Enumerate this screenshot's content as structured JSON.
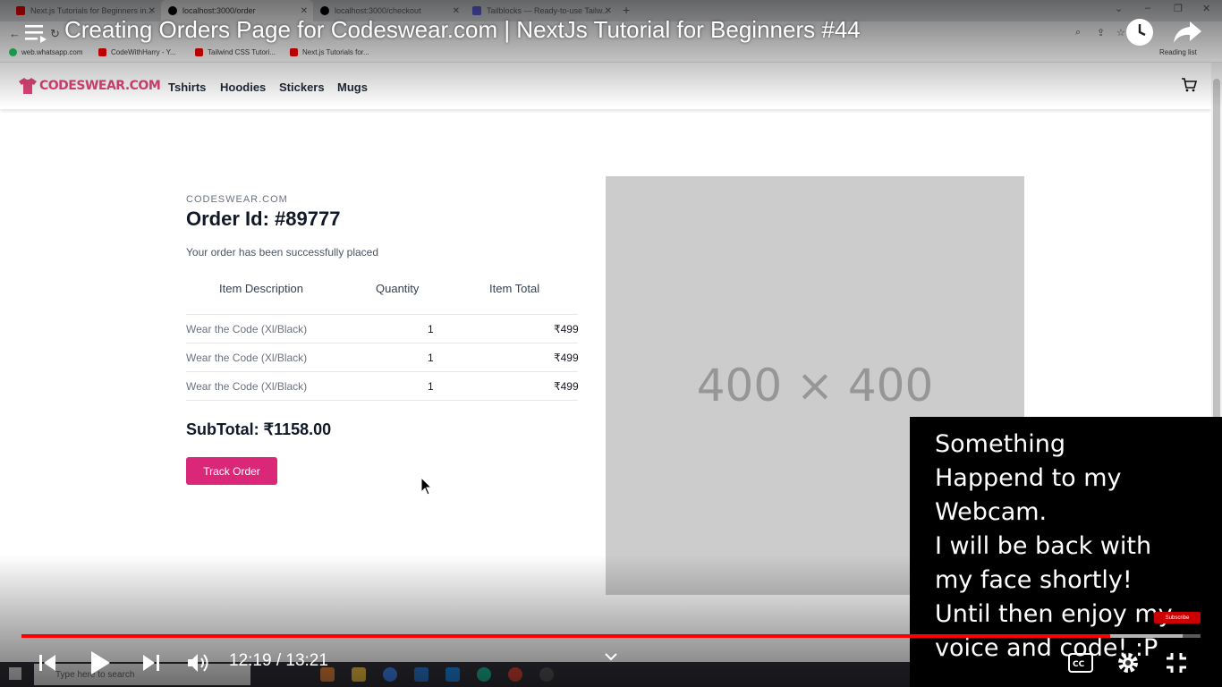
{
  "browser": {
    "tabs": [
      {
        "label": "Next.js Tutorials for Beginners in...",
        "active": false,
        "color": "#ff0000"
      },
      {
        "label": "localhost:3000/order",
        "active": true,
        "color": "#000000"
      },
      {
        "label": "localhost:3000/checkout",
        "active": false,
        "color": "#000000"
      },
      {
        "label": "Tailblocks — Ready-to-use Tailw...",
        "active": false,
        "color": "#6366f1"
      }
    ],
    "bookmarks": [
      {
        "label": "web.whatsapp.com",
        "color": "#25d366"
      },
      {
        "label": "CodeWithHarry - Y...",
        "color": "#ff0000"
      },
      {
        "label": "Tailwind CSS Tutori...",
        "color": "#ff0000"
      },
      {
        "label": "Next.js Tutorials for...",
        "color": "#ff0000"
      }
    ],
    "reading_list": "Reading list"
  },
  "site": {
    "logo_text": "CODESWEAR.COM",
    "nav": [
      "Tshirts",
      "Hoodies",
      "Stickers",
      "Mugs"
    ],
    "accent": "#db2777"
  },
  "order": {
    "brand": "CODESWEAR.COM",
    "title": "Order Id: #89777",
    "message": "Your order has been successfully placed",
    "columns": [
      "Item Description",
      "Quantity",
      "Item Total"
    ],
    "items": [
      {
        "name": "Wear the Code (Xl/Black)",
        "qty": "1",
        "total": "₹499"
      },
      {
        "name": "Wear the Code (Xl/Black)",
        "qty": "1",
        "total": "₹499"
      },
      {
        "name": "Wear the Code (Xl/Black)",
        "qty": "1",
        "total": "₹499"
      }
    ],
    "subtotal": "SubTotal: ₹1158.00",
    "track_button": "Track Order",
    "placeholder_image": "400 × 400"
  },
  "video": {
    "title": "Creating Orders Page for Codeswear.com | NextJs Tutorial for Beginners #44",
    "webcam_message": "Something\nHappend to my\nWebcam.\nI will be back with\nmy face shortly!\nUntil then enjoy my\nvoice and code! :P",
    "subscribe": "Subscribe",
    "time": "12:19 / 13:21",
    "progress_played": 0.923,
    "progress_loaded": 0.985
  },
  "taskbar": {
    "search_placeholder": "Type here to search"
  }
}
